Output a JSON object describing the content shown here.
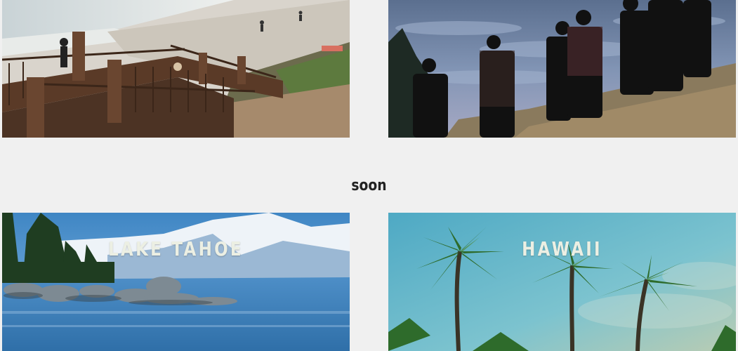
{
  "section": {
    "label": "soon"
  },
  "cards": [
    {
      "title": "",
      "image": "beach-stairs-photo"
    },
    {
      "title": "",
      "image": "people-above-clouds-photo"
    },
    {
      "title": "LAKE TAHOE",
      "image": "lake-tahoe-photo"
    },
    {
      "title": "HAWAII",
      "image": "hawaii-palms-photo"
    }
  ],
  "colors": {
    "background": "#f0f0f0",
    "label": "#222222",
    "title_text": "#ecefe3"
  }
}
